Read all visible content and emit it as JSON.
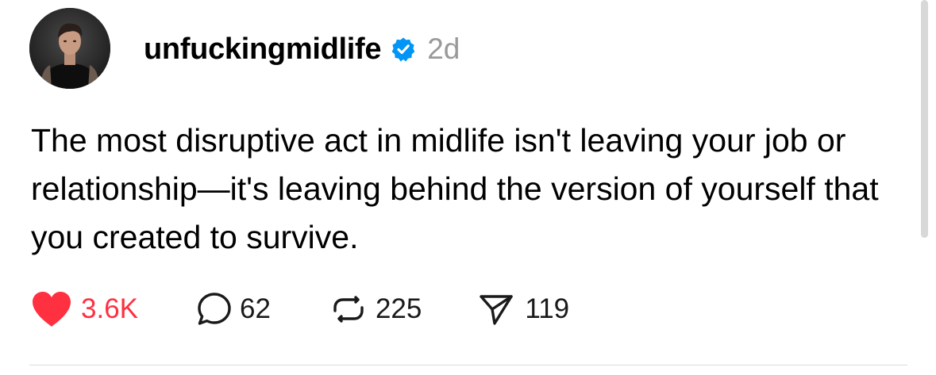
{
  "post": {
    "author": {
      "username": "unfuckingmidlife",
      "verified": true,
      "avatar_icon": "profile-photo"
    },
    "timestamp": "2d",
    "text": "The most disruptive act in midlife isn't leaving your job or relationship—it's leaving behind the version of yourself that you created to survive.",
    "actions": {
      "likes": "3.6K",
      "liked": true,
      "replies": "62",
      "reposts": "225",
      "shares": "119"
    }
  },
  "colors": {
    "like_red": "#ff3040",
    "verified_blue": "#0095f6",
    "timestamp_gray": "#999999",
    "text": "#000000"
  }
}
